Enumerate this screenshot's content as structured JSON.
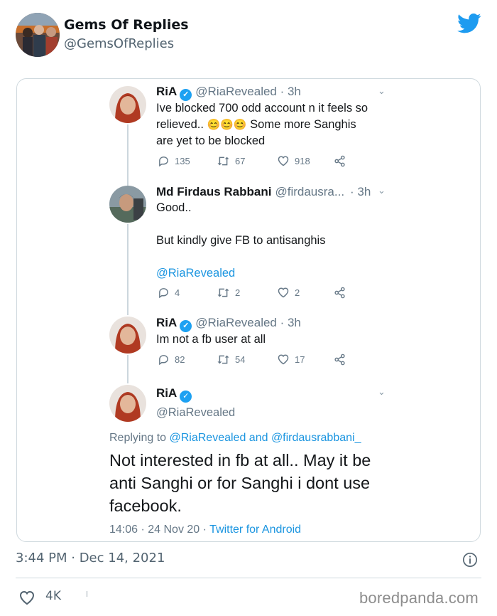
{
  "tweet": {
    "author_name": "Gems Of Replies",
    "author_handle": "@GemsOfReplies",
    "timestamp": "3:44 PM · Dec 14, 2021",
    "like_count": "4K",
    "brand_color": "#1d9bf0"
  },
  "screenshot": {
    "replies": [
      {
        "name": "RiA",
        "verified": true,
        "handle_time": "@RiaRevealed · 3h",
        "text_lines": [
          "Ive blocked 700 odd account n it feels so",
          "relieved.. ",
          " Some more Sanghis",
          "are yet to be blocked"
        ],
        "emojis": "😊😊😊",
        "reply_count": "135",
        "retweet_count": "67",
        "like_count": "918"
      },
      {
        "name": "Md Firdaus Rabbani",
        "verified": false,
        "handle_time": "@firdausra...",
        "time": "· 3h",
        "text_1": "Good..",
        "text_2": "But kindly give FB to antisanghis",
        "mention": "@RiaRevealed",
        "reply_count": "4",
        "retweet_count": "2",
        "like_count": "2"
      },
      {
        "name": "RiA",
        "verified": true,
        "handle_time": "@RiaRevealed · 3h",
        "text": "Im not a fb user at all",
        "reply_count": "82",
        "retweet_count": "54",
        "like_count": "17"
      }
    ],
    "main": {
      "name": "RiA",
      "handle": "@RiaRevealed",
      "replying_label": "Replying to",
      "replying_to": "@RiaRevealed and @firdausrabbani_",
      "text": "Not interested in fb at all.. May it be anti Sanghi or for Sanghi i dont use facebook.",
      "time_date": "14:06 · 24 Nov 20 ·",
      "source": "Twitter for Android"
    }
  },
  "watermark": "boredpanda.com",
  "icons": [
    "twitter-bird-icon",
    "verified-icon",
    "chevron-down-icon",
    "reply-icon",
    "retweet-icon",
    "heart-icon",
    "share-icon",
    "info-icon"
  ]
}
